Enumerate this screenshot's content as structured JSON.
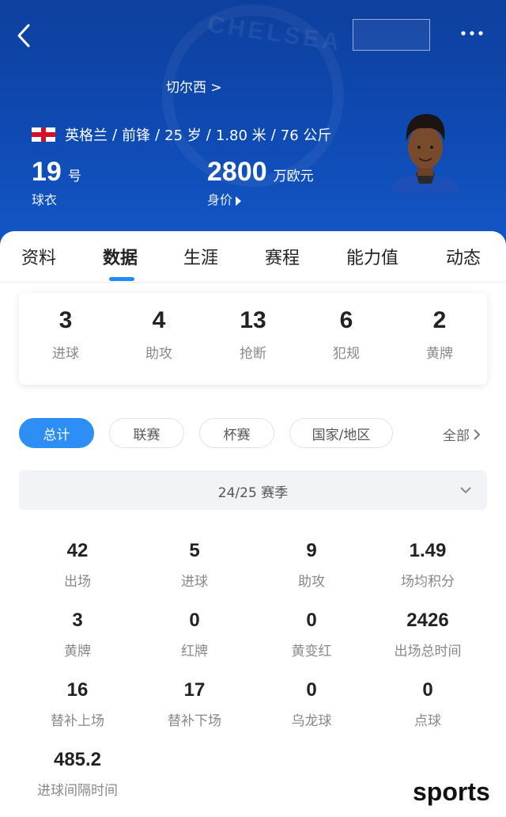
{
  "header": {
    "crest_text": "CHELSEA",
    "club": "切尔西 >",
    "nationality": "英格兰",
    "position": "前锋",
    "age": "25 岁",
    "height": "1.80 米",
    "weight": "76 公斤",
    "shirt_number": "19",
    "shirt_unit": "号",
    "shirt_label": "球衣",
    "value": "2800",
    "value_unit": "万欧元",
    "value_label": "身价"
  },
  "tabs": [
    "资料",
    "数据",
    "生涯",
    "赛程",
    "能力值",
    "动态"
  ],
  "active_tab": "数据",
  "summary": [
    {
      "value": "3",
      "label": "进球"
    },
    {
      "value": "4",
      "label": "助攻"
    },
    {
      "value": "13",
      "label": "抢断"
    },
    {
      "value": "6",
      "label": "犯规"
    },
    {
      "value": "2",
      "label": "黄牌"
    }
  ],
  "filters": [
    "总计",
    "联赛",
    "杯赛",
    "国家/地区"
  ],
  "active_filter": "总计",
  "all_label": "全部",
  "season": "24/25 赛季",
  "stats": [
    {
      "value": "42",
      "label": "出场"
    },
    {
      "value": "5",
      "label": "进球"
    },
    {
      "value": "9",
      "label": "助攻"
    },
    {
      "value": "1.49",
      "label": "场均积分"
    },
    {
      "value": "3",
      "label": "黄牌"
    },
    {
      "value": "0",
      "label": "红牌"
    },
    {
      "value": "0",
      "label": "黄变红"
    },
    {
      "value": "2426",
      "label": "出场总时间"
    },
    {
      "value": "16",
      "label": "替补上场"
    },
    {
      "value": "17",
      "label": "替补下场"
    },
    {
      "value": "0",
      "label": "乌龙球"
    },
    {
      "value": "0",
      "label": "点球"
    },
    {
      "value": "485.2",
      "label": "进球间隔时间"
    }
  ],
  "watermark": "sports",
  "colors": {
    "header": "#0f4bb4",
    "accent": "#2d8ff5",
    "flag_red": "#d2102b"
  },
  "icons": [
    "back-arrow-icon",
    "more-dots-icon",
    "england-flag-icon",
    "chevron-down-icon",
    "chevron-right-icon"
  ]
}
